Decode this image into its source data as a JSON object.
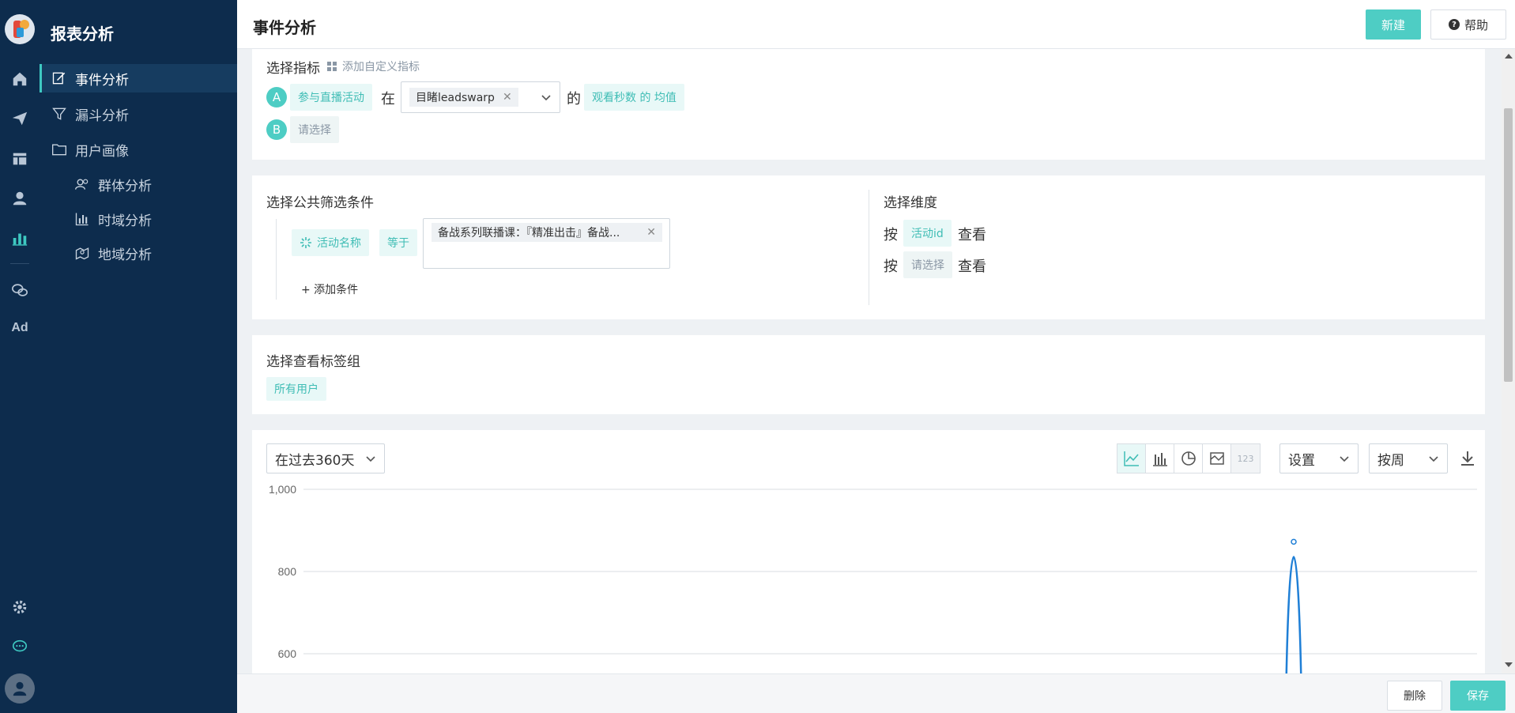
{
  "app": {
    "title": "报表分析",
    "rail": {
      "ad_label": "Ad"
    }
  },
  "sidebar": {
    "items": [
      {
        "label": "事件分析",
        "icon": "edit-icon",
        "active": true
      },
      {
        "label": "漏斗分析",
        "icon": "funnel-icon"
      },
      {
        "label": "用户画像",
        "icon": "folder-icon"
      },
      {
        "label": "群体分析",
        "icon": "users-icon"
      },
      {
        "label": "时域分析",
        "icon": "bar-chart-icon"
      },
      {
        "label": "地域分析",
        "icon": "map-icon"
      }
    ]
  },
  "header": {
    "title": "事件分析",
    "new_label": "新建",
    "help_label": "帮助",
    "help_glyph": "?"
  },
  "metrics": {
    "title": "选择指标",
    "add_custom_label": "添加自定义指标",
    "row_a": {
      "badge": "A",
      "event": "参与直播活动",
      "word_in": "在",
      "tag": "目睹leadswarp",
      "word_of": "的",
      "measure": "观看秒数 的 均值"
    },
    "row_b": {
      "badge": "B",
      "placeholder": "请选择"
    }
  },
  "filters": {
    "title": "选择公共筛选条件",
    "field": "活动名称",
    "operator": "等于",
    "value_tag": "备战系列联播课：『精准出击』备战...",
    "add_condition": "+ 添加条件"
  },
  "dimensions": {
    "title": "选择维度",
    "row1": {
      "prefix": "按",
      "chip": "活动id",
      "suffix": "查看"
    },
    "row2": {
      "prefix": "按",
      "chip": "请选择",
      "suffix": "查看"
    }
  },
  "tag_group": {
    "title": "选择查看标签组",
    "chip": "所有用户"
  },
  "chart_panel": {
    "range_label": "在过去360天",
    "tools": [
      "line-chart-icon",
      "bar-chart-icon",
      "pie-chart-icon",
      "area-chart-icon",
      "number-icon"
    ],
    "number_tool_text": "123",
    "settings_label": "设置",
    "granularity_label": "按周"
  },
  "chart_data": {
    "type": "line",
    "ylim": [
      600,
      1000
    ],
    "yticks": [
      "1,000",
      "800",
      "600"
    ],
    "series": [
      {
        "values": [
          880
        ]
      }
    ],
    "line_color": "#1f7fd6"
  },
  "footer": {
    "delete_label": "删除",
    "save_label": "保存"
  },
  "colors": {
    "accent": "#4ecdc4",
    "sidebar_bg": "#0d2c4d"
  }
}
